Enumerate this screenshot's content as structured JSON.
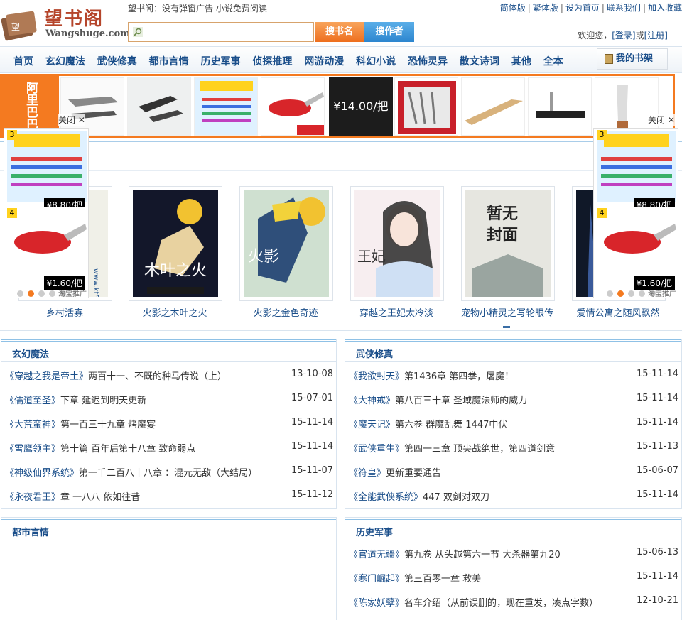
{
  "header": {
    "logo_text": "望书阁",
    "logo_domain": "Wangshuge.com",
    "slogan": "望书阁：没有弹窗广告 小说免费阅读",
    "top_links": [
      "简体版",
      "繁体版",
      "设为首页",
      "联系我们",
      "加入收藏"
    ],
    "search_btn_name": "搜书名",
    "search_btn_author": "搜作者",
    "welcome_prefix": "欢迎您，",
    "login": "[登录]",
    "or": "或",
    "register": "[注册]"
  },
  "nav": {
    "items": [
      "首页",
      "玄幻魔法",
      "武侠修真",
      "都市言情",
      "历史军事",
      "侦探推理",
      "网游动漫",
      "科幻小说",
      "恐怖灵异",
      "散文诗词",
      "其他",
      "全本"
    ],
    "shelf": "我的书架"
  },
  "ad": {
    "brand": "阿里巴巴",
    "price_banner": "¥14.00/把",
    "close_label": "关闭",
    "close_x": "✕",
    "side_prices": [
      "¥8.80/把",
      "¥1.60/把"
    ],
    "side_nums": [
      "3",
      "4"
    ],
    "taobao_label": "淘宝推广",
    "colors": {
      "accent": "#f47a20"
    }
  },
  "recommend": {
    "titles": [
      "乡村活寡",
      "火影之木叶之火",
      "火影之金色奇迹",
      "穿越之王妃太冷淡",
      "宠物小精灵之写轮眼传",
      "爱情公寓之随风飘然"
    ]
  },
  "sections": [
    {
      "title": "玄幻魔法",
      "rows": [
        {
          "book": "《穿越之我是帝土》",
          "chapter": "两百十一、不既的种马传说（上）",
          "date": "13-10-08"
        },
        {
          "book": "《儒道至圣》",
          "chapter": "下章 延迟到明天更新",
          "date": "15-07-01"
        },
        {
          "book": "《大荒蛮神》",
          "chapter": "第一百三十九章 烤魔宴",
          "date": "15-11-14"
        },
        {
          "book": "《雪鹰领主》",
          "chapter": "第十篇 百年后第十八章 致命弱点",
          "date": "15-11-14"
        },
        {
          "book": "《神级仙界系统》",
          "chapter": "第一千二百八十八章 ：混元无敌（大结局）",
          "date": "15-11-07"
        },
        {
          "book": "《永夜君王》",
          "chapter": "章 一八八 依如往昔",
          "date": "15-11-12"
        }
      ]
    },
    {
      "title": "武侠修真",
      "rows": [
        {
          "book": "《我欲封天》",
          "chapter": "第1436章 第四拳，屠魔！",
          "date": "15-11-14"
        },
        {
          "book": "《大神戒》",
          "chapter": "第八百三十章 圣域魔法师的威力",
          "date": "15-11-14"
        },
        {
          "book": "《魔天记》",
          "chapter": "第六卷 群魔乱舞 1447中伏",
          "date": "15-11-14"
        },
        {
          "book": "《武侠重生》",
          "chapter": "第四一三章 顶尖战绝世，第四道剑意",
          "date": "15-11-13"
        },
        {
          "book": "《符皇》",
          "chapter": "更新重要通告",
          "date": "15-06-07"
        },
        {
          "book": "《全能武侠系统》",
          "chapter": "447 双剑对双刀",
          "date": "15-11-14"
        }
      ]
    },
    {
      "title": "都市言情",
      "rows": []
    },
    {
      "title": "历史军事",
      "rows": [
        {
          "book": "《官道无疆》",
          "chapter": "第九卷 从头越第六一节 大杀器第九20",
          "date": "15-06-13"
        },
        {
          "book": "《寒门崛起》",
          "chapter": "第三百零一章 救美",
          "date": "15-11-14"
        },
        {
          "book": "《陈家妖孽》",
          "chapter": "名车介绍（从前误删的，现在重发，凑点字数）",
          "date": "12-10-21"
        }
      ]
    }
  ]
}
